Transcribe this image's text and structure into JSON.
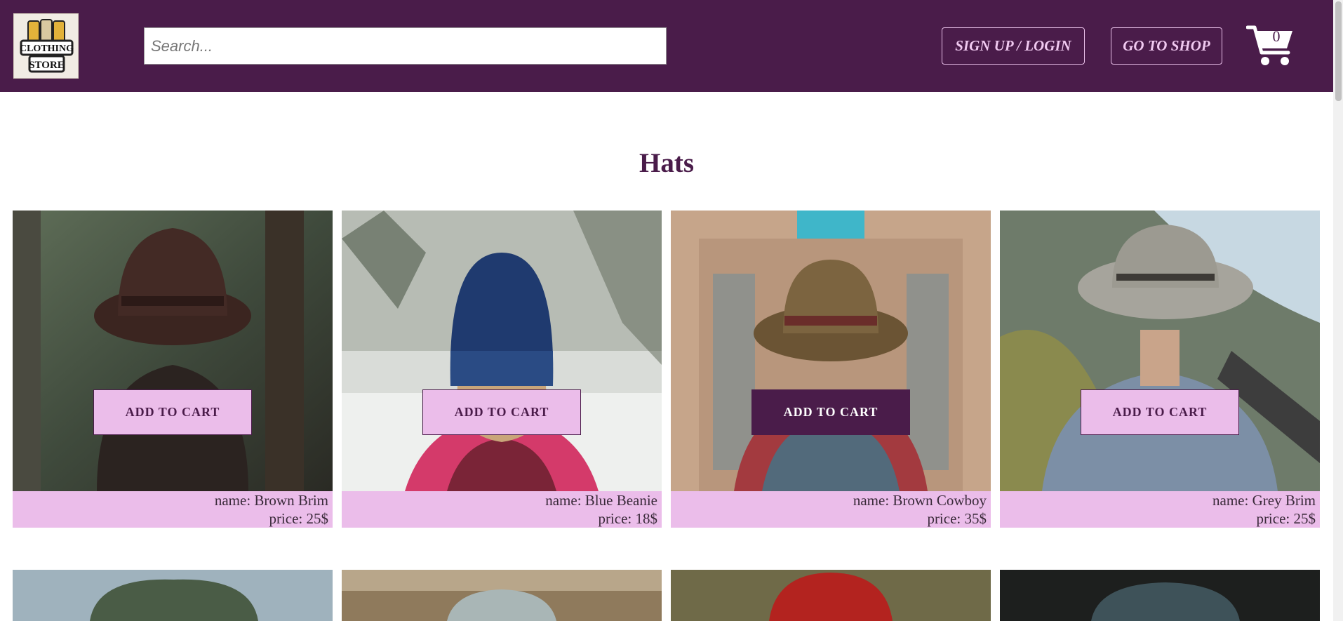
{
  "header": {
    "logo_alt": "Clothing Store",
    "logo_text_top": "CLOTHING",
    "logo_text_bottom": "STORE",
    "search": {
      "placeholder": "Search...",
      "value": ""
    },
    "signup_label": "SIGN UP / LOGIN",
    "shop_label": "GO TO SHOP",
    "cart_count": "0"
  },
  "colors": {
    "brand": "#4a1c4a",
    "accent": "#ebbdea",
    "background": "#ffffff"
  },
  "section": {
    "title": "Hats"
  },
  "products": [
    {
      "name_line": "name: Brown Brim",
      "price_line": "price: 25$",
      "button": "ADD TO CART",
      "image": "brown-brim-hat-photo"
    },
    {
      "name_line": "name: Blue Beanie",
      "price_line": "price: 18$",
      "button": "ADD TO CART",
      "image": "blue-beanie-photo"
    },
    {
      "name_line": "name: Brown Cowboy",
      "price_line": "price: 35$",
      "button": "ADD TO CART",
      "image": "brown-cowboy-hat-photo"
    },
    {
      "name_line": "name: Grey Brim",
      "price_line": "price: 25$",
      "button": "ADD TO CART",
      "image": "grey-brim-hat-photo"
    }
  ],
  "next_row_images": [
    "green-beanie-photo",
    "grey-cap-photo",
    "red-beanie-photo",
    "blue-cap-photo"
  ]
}
